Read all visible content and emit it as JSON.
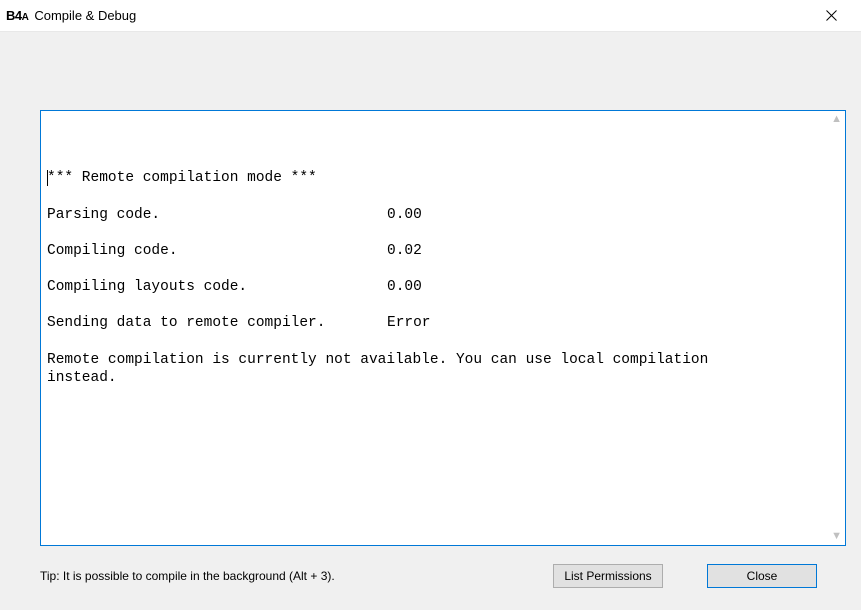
{
  "titlebar": {
    "logo_main": "B4",
    "logo_suffix": "A",
    "title": "Compile & Debug"
  },
  "log": {
    "header": "*** Remote compilation mode ***",
    "rows": [
      {
        "label": "Parsing code.",
        "value": "0.00"
      },
      {
        "label": "Compiling code.",
        "value": "0.02"
      },
      {
        "label": "Compiling layouts code.",
        "value": "0.00"
      },
      {
        "label": "Sending data to remote compiler.",
        "value": "Error"
      }
    ],
    "message": "Remote compilation is currently not available. You can use local compilation\ninstead."
  },
  "footer": {
    "tip": "Tip: It is possible to compile in the background (Alt + 3).",
    "list_permissions": "List Permissions",
    "close": "Close"
  },
  "scroll": {
    "up": "▲",
    "down": "▼"
  }
}
